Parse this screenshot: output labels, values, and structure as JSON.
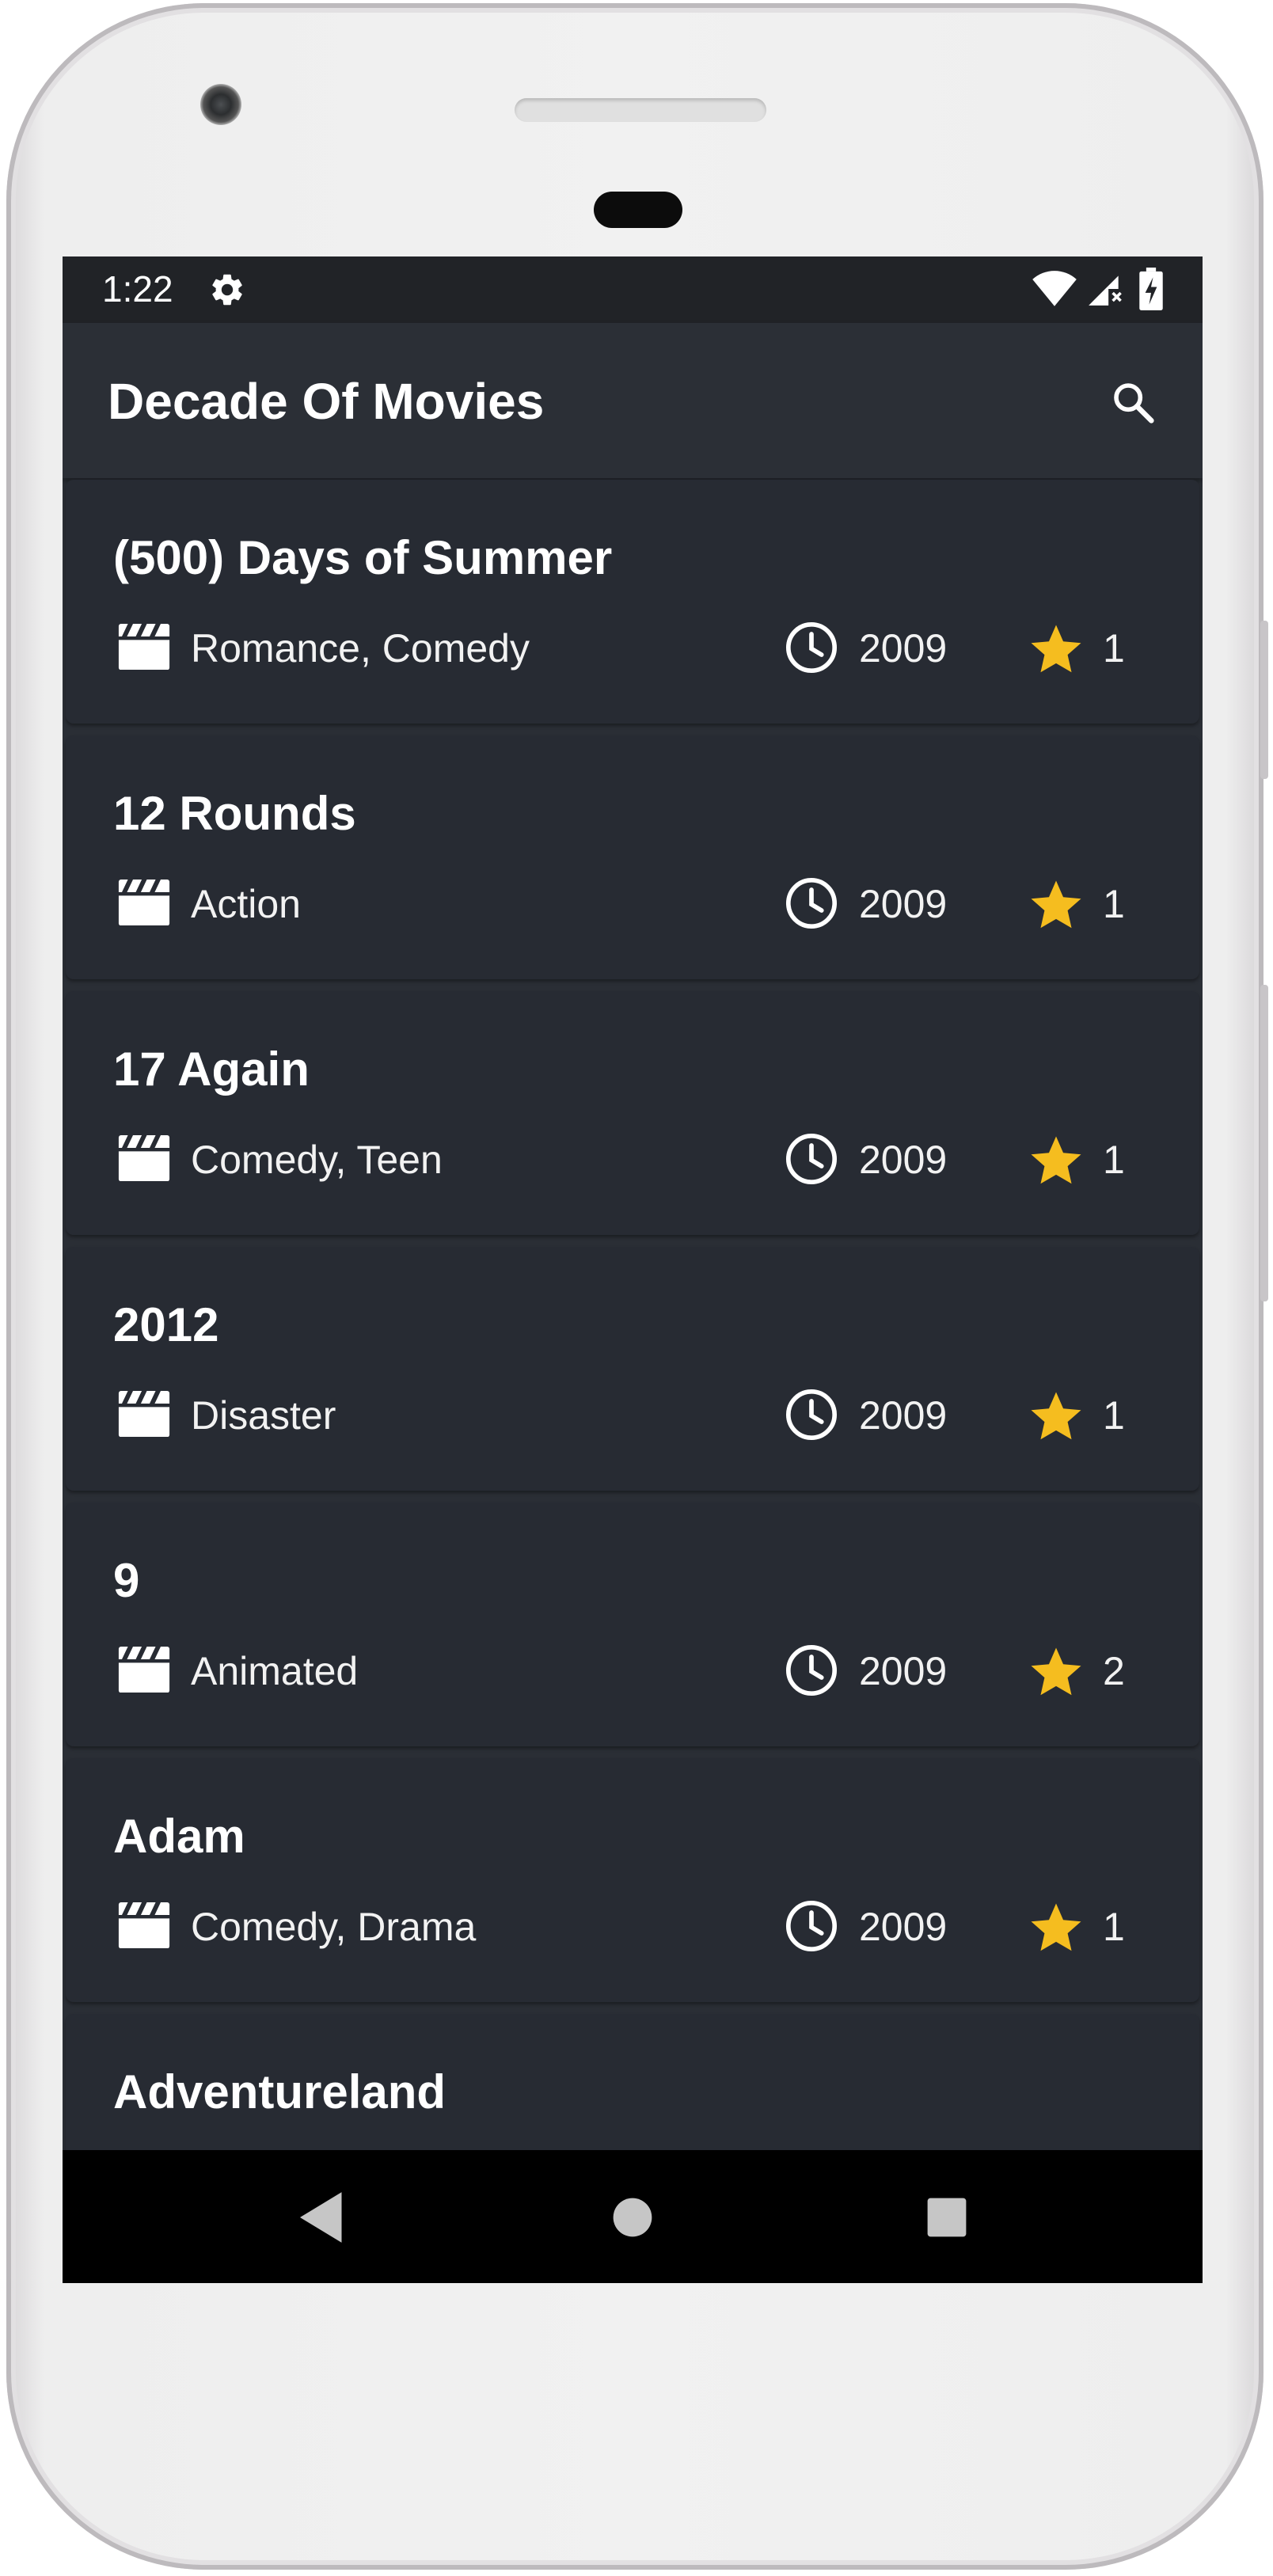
{
  "status_bar": {
    "time": "1:22",
    "icons": [
      "settings-icon",
      "wifi-icon",
      "cell-signal-icon",
      "battery-icon"
    ]
  },
  "app_bar": {
    "title": "Decade Of Movies",
    "search_icon": "search-icon"
  },
  "colors": {
    "background": "#2a2e35",
    "card": "#272b33",
    "status_bar": "#212327",
    "star": "#f5bd1f",
    "text": "#ffffff"
  },
  "movies": [
    {
      "title": "(500) Days of Summer",
      "genres": "Romance, Comedy",
      "year": "2009",
      "rating": "1"
    },
    {
      "title": "12 Rounds",
      "genres": "Action",
      "year": "2009",
      "rating": "1"
    },
    {
      "title": "17 Again",
      "genres": "Comedy, Teen",
      "year": "2009",
      "rating": "1"
    },
    {
      "title": "2012",
      "genres": "Disaster",
      "year": "2009",
      "rating": "1"
    },
    {
      "title": "9",
      "genres": "Animated",
      "year": "2009",
      "rating": "2"
    },
    {
      "title": "Adam",
      "genres": "Comedy, Drama",
      "year": "2009",
      "rating": "1"
    },
    {
      "title": "Adventureland",
      "genres": "",
      "year": "",
      "rating": ""
    }
  ],
  "nav_bar": {
    "buttons": [
      "back-icon",
      "home-icon",
      "recents-icon"
    ]
  }
}
